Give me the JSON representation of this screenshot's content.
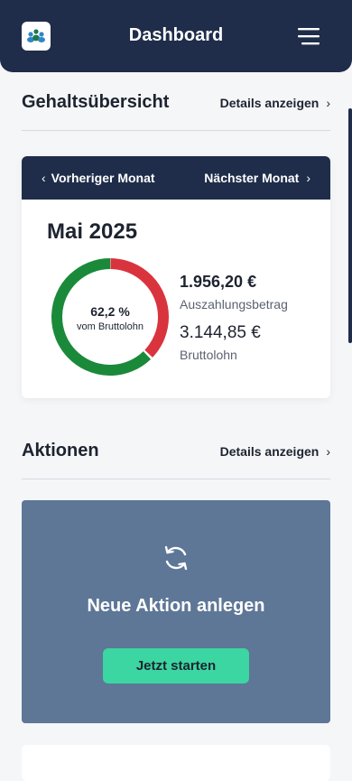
{
  "header": {
    "title": "Dashboard",
    "logo_icon": "team-logo-icon",
    "menu_icon": "hamburger-menu-icon"
  },
  "salary_section": {
    "title": "Gehaltsübersicht",
    "details_label": "Details anzeigen",
    "nav": {
      "prev_label": "Vorheriger Monat",
      "next_label": "Nächster Monat"
    },
    "month": "Mai 2025",
    "donut": {
      "percent_label": "62,2 %",
      "sub_label": "vom Bruttolohn",
      "payout_fraction": 0.622,
      "payout_color": "#1a8a3a",
      "rest_color": "#d9343d"
    },
    "payout": {
      "value": "1.956,20 €",
      "label": "Auszahlungsbetrag"
    },
    "gross": {
      "value": "3.144,85 €",
      "label": "Bruttolohn"
    }
  },
  "actions_section": {
    "title": "Aktionen",
    "details_label": "Details anzeigen",
    "card": {
      "icon": "refresh-icon",
      "title": "Neue Aktion anlegen",
      "button_label": "Jetzt starten"
    }
  },
  "colors": {
    "navy": "#1f2d4a",
    "action_bg": "#5e7797",
    "button": "#3bd6a1"
  }
}
